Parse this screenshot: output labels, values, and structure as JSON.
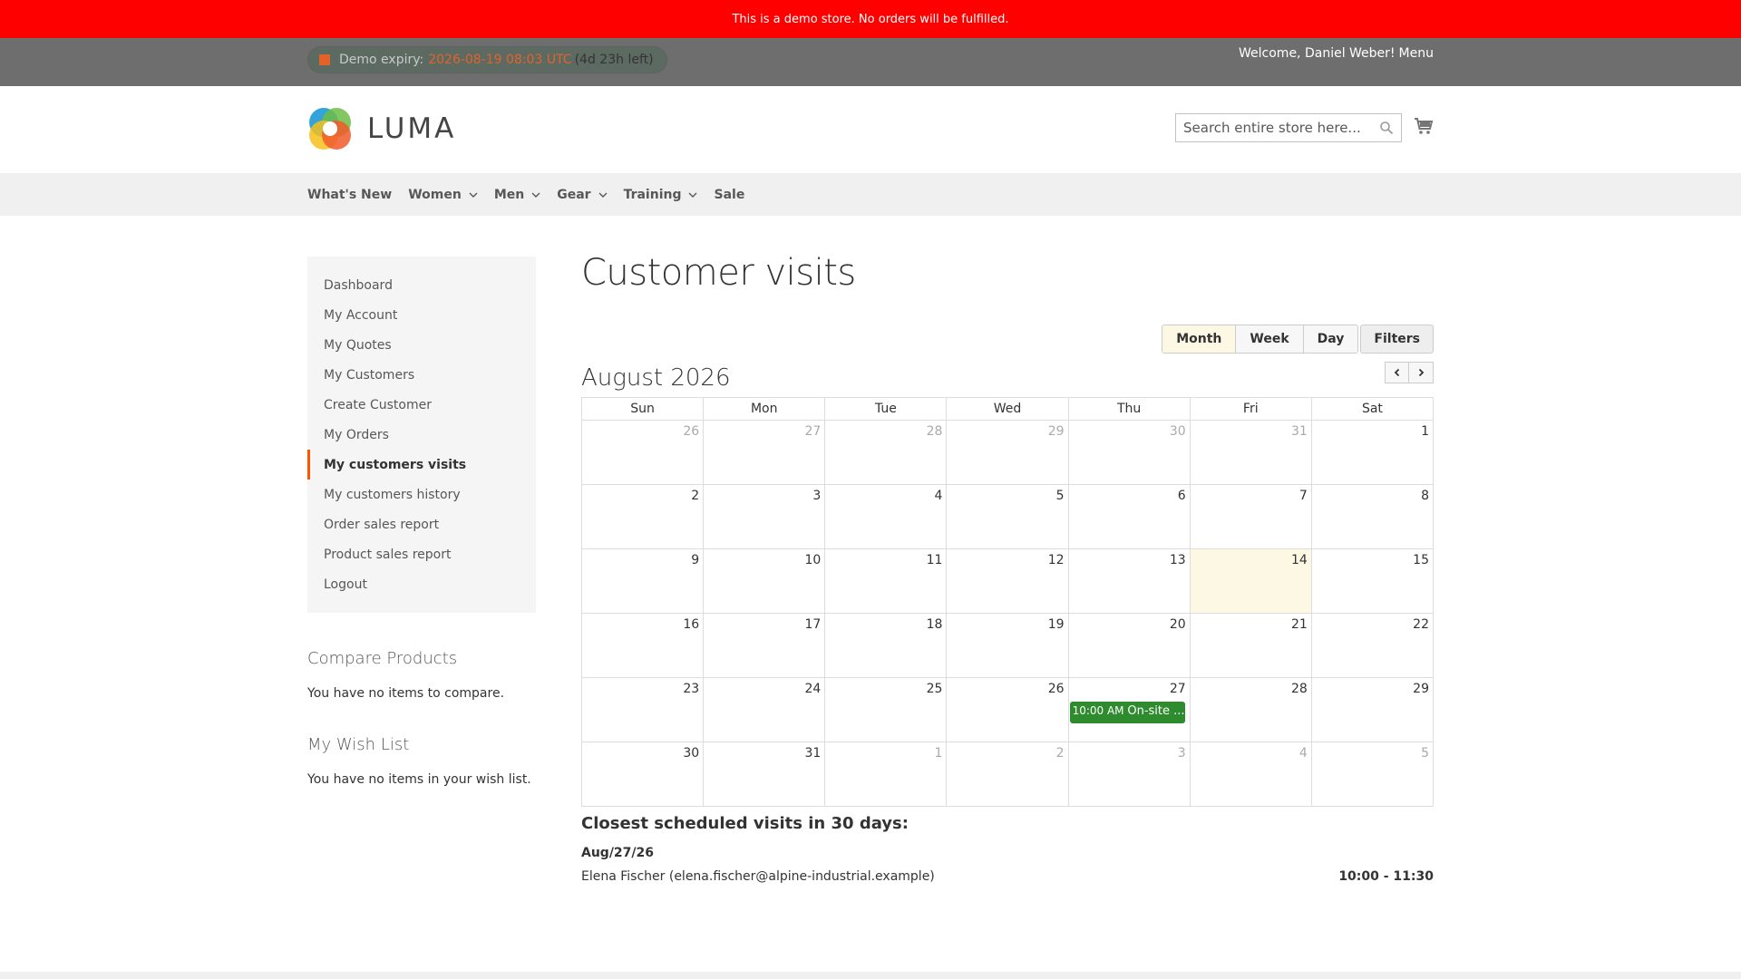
{
  "banner": {
    "text": "This is a demo store. No orders will be fulfilled."
  },
  "panel": {
    "expiry_label": "Demo expiry:",
    "expiry_date": "2026-08-19 08:03 UTC",
    "expiry_left": "(4d 23h left)",
    "welcome": "Welcome, Daniel Weber!",
    "menu": "Menu"
  },
  "header": {
    "logo_text": "LUMA",
    "search_placeholder": "Search entire store here..."
  },
  "nav": {
    "items": [
      {
        "label": "What's New",
        "dropdown": false
      },
      {
        "label": "Women",
        "dropdown": true
      },
      {
        "label": "Men",
        "dropdown": true
      },
      {
        "label": "Gear",
        "dropdown": true
      },
      {
        "label": "Training",
        "dropdown": true
      },
      {
        "label": "Sale",
        "dropdown": false
      }
    ]
  },
  "sidebar": {
    "items": [
      {
        "label": "Dashboard",
        "active": false
      },
      {
        "label": "My Account",
        "active": false
      },
      {
        "label": "My Quotes",
        "active": false
      },
      {
        "label": "My Customers",
        "active": false
      },
      {
        "label": "Create Customer",
        "active": false
      },
      {
        "label": "My Orders",
        "active": false
      },
      {
        "label": "My customers visits",
        "active": true
      },
      {
        "label": "My customers history",
        "active": false
      },
      {
        "label": "Order sales report",
        "active": false
      },
      {
        "label": "Product sales report",
        "active": false
      },
      {
        "label": "Logout",
        "active": false
      }
    ],
    "compare_title": "Compare Products",
    "compare_text": "You have no items to compare.",
    "wishlist_title": "My Wish List",
    "wishlist_text": "You have no items in your wish list."
  },
  "page": {
    "title": "Customer visits",
    "views": [
      "Month",
      "Week",
      "Day"
    ],
    "active_view": "Month",
    "filters": "Filters",
    "month_title": "August 2026"
  },
  "calendar": {
    "weekdays": [
      "Sun",
      "Mon",
      "Tue",
      "Wed",
      "Thu",
      "Fri",
      "Sat"
    ],
    "weeks": [
      [
        {
          "d": "26",
          "other": true
        },
        {
          "d": "27",
          "other": true
        },
        {
          "d": "28",
          "other": true
        },
        {
          "d": "29",
          "other": true
        },
        {
          "d": "30",
          "other": true
        },
        {
          "d": "31",
          "other": true
        },
        {
          "d": "1"
        }
      ],
      [
        {
          "d": "2"
        },
        {
          "d": "3"
        },
        {
          "d": "4"
        },
        {
          "d": "5"
        },
        {
          "d": "6"
        },
        {
          "d": "7"
        },
        {
          "d": "8"
        }
      ],
      [
        {
          "d": "9"
        },
        {
          "d": "10"
        },
        {
          "d": "11"
        },
        {
          "d": "12"
        },
        {
          "d": "13"
        },
        {
          "d": "14",
          "today": true
        },
        {
          "d": "15"
        }
      ],
      [
        {
          "d": "16"
        },
        {
          "d": "17"
        },
        {
          "d": "18"
        },
        {
          "d": "19"
        },
        {
          "d": "20"
        },
        {
          "d": "21"
        },
        {
          "d": "22"
        }
      ],
      [
        {
          "d": "23"
        },
        {
          "d": "24"
        },
        {
          "d": "25"
        },
        {
          "d": "26"
        },
        {
          "d": "27",
          "event": {
            "time": "10:00 AM",
            "title": "On-site ..."
          }
        },
        {
          "d": "28"
        },
        {
          "d": "29"
        }
      ],
      [
        {
          "d": "30"
        },
        {
          "d": "31"
        },
        {
          "d": "1",
          "other": true
        },
        {
          "d": "2",
          "other": true
        },
        {
          "d": "3",
          "other": true
        },
        {
          "d": "4",
          "other": true
        },
        {
          "d": "5",
          "other": true
        }
      ]
    ],
    "event_color": "#2e8b2e",
    "today_color": "#fcf8e3"
  },
  "closest": {
    "title": "Closest scheduled visits in 30 days:",
    "date": "Aug/27/26",
    "customer": "Elena Fischer (elena.fischer@alpine-industrial.example)",
    "time": "10:00 - 11:30"
  },
  "colors": {
    "banner": "#ff0000",
    "accent": "#ff5501",
    "panel": "#6e6e6e"
  }
}
